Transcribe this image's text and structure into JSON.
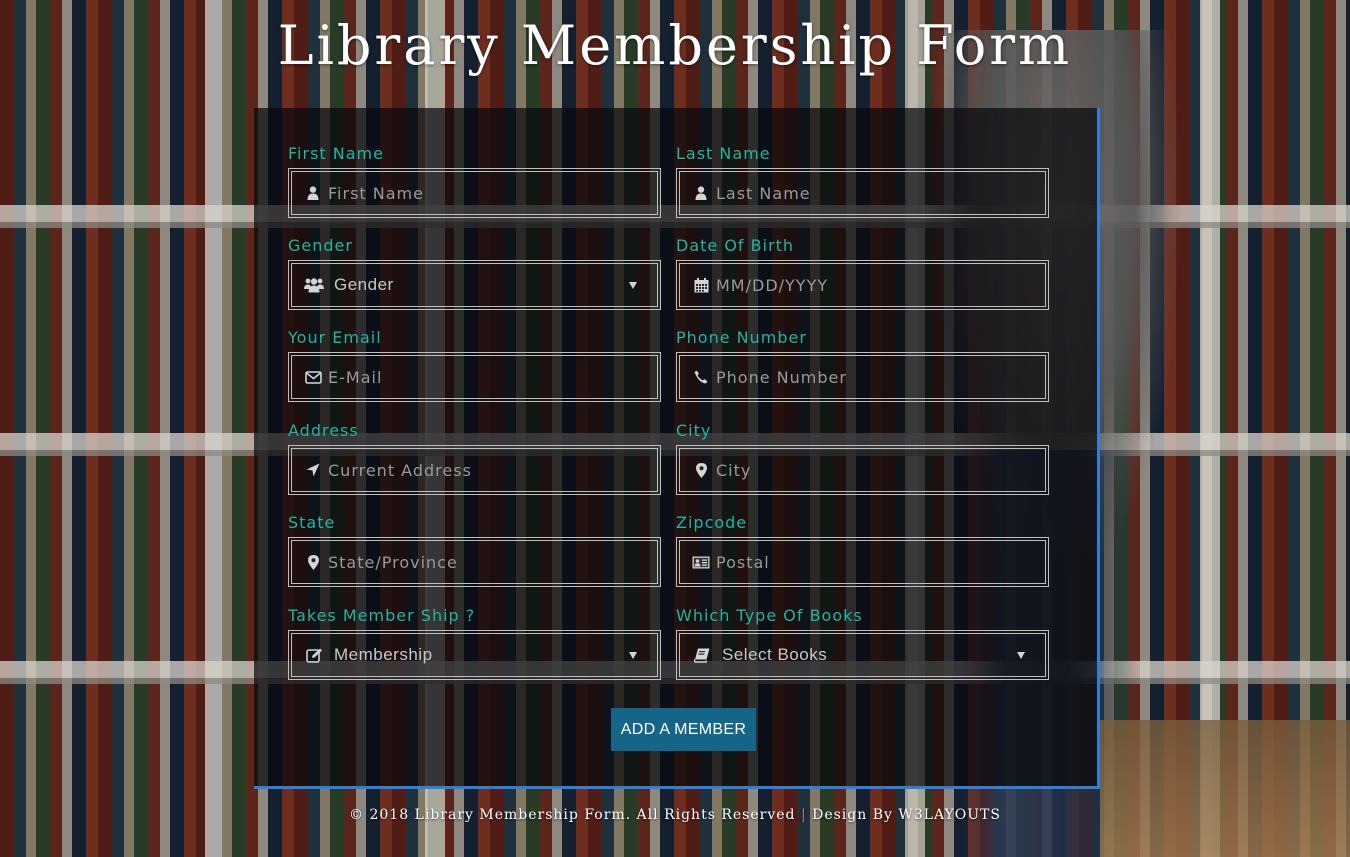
{
  "page": {
    "title": "Library Membership Form"
  },
  "colors": {
    "label": "#1fb5a0",
    "accent_border": "#2f7fd6",
    "button_bg": "#156589"
  },
  "form": {
    "fields": [
      {
        "id": "first_name",
        "label": "First Name",
        "type": "input",
        "placeholder": "First Name",
        "value": "",
        "icon": "user-icon"
      },
      {
        "id": "last_name",
        "label": "Last Name",
        "type": "input",
        "placeholder": "Last Name",
        "value": "",
        "icon": "user-icon"
      },
      {
        "id": "gender",
        "label": "Gender",
        "type": "select",
        "selected": "Gender",
        "icon": "users-icon"
      },
      {
        "id": "dob",
        "label": "Date Of Birth",
        "type": "input",
        "placeholder": "MM/DD/YYYY",
        "value": "",
        "icon": "calendar-icon"
      },
      {
        "id": "email",
        "label": "Your Email",
        "type": "input",
        "placeholder": "E-Mail",
        "value": "",
        "icon": "envelope-icon"
      },
      {
        "id": "phone",
        "label": "Phone Number",
        "type": "input",
        "placeholder": "Phone Number",
        "value": "",
        "icon": "phone-icon"
      },
      {
        "id": "address",
        "label": "Address",
        "type": "input",
        "placeholder": "Current Address",
        "value": "",
        "icon": "location-arrow-icon"
      },
      {
        "id": "city",
        "label": "City",
        "type": "input",
        "placeholder": "City",
        "value": "",
        "icon": "map-marker-icon"
      },
      {
        "id": "state",
        "label": "State",
        "type": "input",
        "placeholder": "State/Province",
        "value": "",
        "icon": "map-marker-icon"
      },
      {
        "id": "zipcode",
        "label": "Zipcode",
        "type": "input",
        "placeholder": "Postal",
        "value": "",
        "icon": "address-card-icon"
      },
      {
        "id": "membership",
        "label": "Takes Member Ship ?",
        "type": "select",
        "selected": "Membership",
        "icon": "edit-icon"
      },
      {
        "id": "books",
        "label": "Which Type Of Books",
        "type": "select",
        "selected": "Select Books",
        "icon": "book-icon"
      }
    ],
    "submit_label": "ADD A MEMBER"
  },
  "footer": {
    "copyright": "© 2018 Library Membership Form. All Rights Reserved",
    "separator": "|",
    "design_by": "Design By",
    "designer": "W3LAYOUTS"
  }
}
